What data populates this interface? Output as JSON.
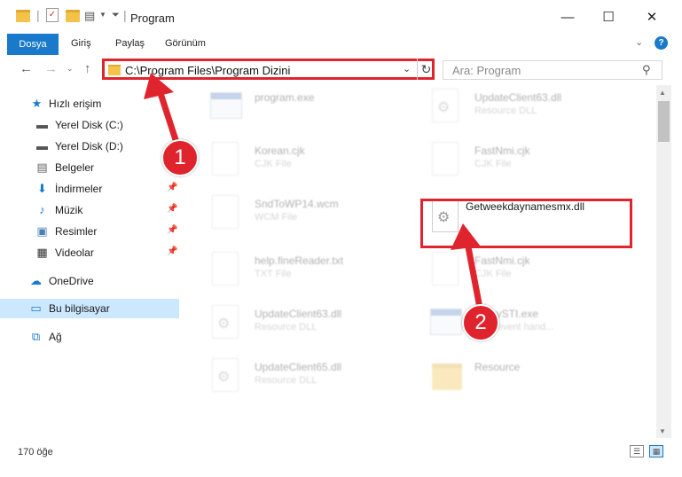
{
  "window": {
    "title": "Program",
    "minimize": "—",
    "maximize": "☐",
    "close": "✕"
  },
  "ribbon": {
    "file_tab": "Dosya",
    "tabs": [
      "Giriş",
      "Paylaş",
      "Görünüm"
    ],
    "help": "?"
  },
  "address": {
    "path": "C:\\Program Files\\Program Dizini",
    "search_placeholder": "Ara: Program"
  },
  "sidebar": {
    "items": [
      {
        "label": "Hızlı erişim",
        "icon": "star-icon"
      },
      {
        "label": "Yerel Disk (C:)",
        "icon": "drive-icon"
      },
      {
        "label": "Yerel Disk (D:)",
        "icon": "drive-icon"
      },
      {
        "label": "Belgeler",
        "icon": "document-icon"
      },
      {
        "label": "İndirmeler",
        "icon": "download-icon"
      },
      {
        "label": "Müzik",
        "icon": "music-icon"
      },
      {
        "label": "Resimler",
        "icon": "pictures-icon"
      },
      {
        "label": "Videolar",
        "icon": "video-icon"
      },
      {
        "label": "OneDrive",
        "icon": "cloud-icon"
      },
      {
        "label": "Bu bilgisayar",
        "icon": "computer-icon"
      },
      {
        "label": "Ağ",
        "icon": "network-icon"
      }
    ]
  },
  "files": [
    {
      "name": "program.exe",
      "type": "",
      "icon": "exe"
    },
    {
      "name": "UpdateClient63.dll",
      "type": "Resource DLL",
      "icon": "dll"
    },
    {
      "name": "Korean.cjk",
      "type": "CJK File",
      "icon": "file"
    },
    {
      "name": "FastNmi.cjk",
      "type": "CJK File",
      "icon": "file"
    },
    {
      "name": "SndToWP14.wcm",
      "type": "WCM File",
      "icon": "file"
    },
    {
      "name": "Getweekdaynamesmx.dll",
      "type": "",
      "icon": "dll"
    },
    {
      "name": "help.fineReader.txt",
      "type": "TXT File",
      "icon": "file"
    },
    {
      "name": "FastNmi.cjk",
      "type": "CJK File",
      "icon": "file"
    },
    {
      "name": "UpdateClient63.dll",
      "type": "Resource DLL",
      "icon": "dll"
    },
    {
      "name": "ProxySTI.exe",
      "type": "Host event hand...",
      "icon": "exe"
    },
    {
      "name": "UpdateClient65.dll",
      "type": "Resource DLL",
      "icon": "dll"
    },
    {
      "name": "Resource",
      "type": "",
      "icon": "folder"
    }
  ],
  "status": {
    "item_count": "170 öğe"
  },
  "annotations": {
    "step1": "1",
    "step2": "2"
  },
  "colors": {
    "accent": "#1979ca",
    "highlight": "#e0242e",
    "selection": "#cce8ff"
  }
}
